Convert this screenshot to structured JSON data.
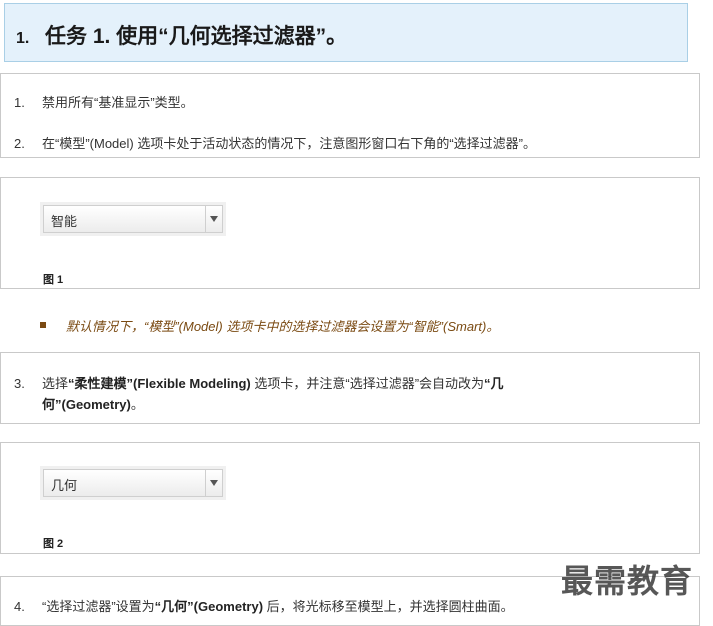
{
  "task": {
    "number": "1.",
    "title": "任务 1. 使用“几何选择过滤器”。"
  },
  "steps_a": [
    {
      "num": "1.",
      "text": "禁用所有“基准显示”类型。"
    },
    {
      "num": "2.",
      "text": "在“模型”(Model) 选项卡处于活动状态的情况下，注意图形窗口右下角的“选择过滤器”。"
    }
  ],
  "figure1": {
    "dropdown_value": "智能",
    "caption": "图 1"
  },
  "note": {
    "text": "默认情况下，“模型”(Model) 选项卡中的选择过滤器会设置为“智能”(Smart)。"
  },
  "step3": {
    "num": "3.",
    "part1": "选择",
    "bold1": "“柔性建模”(Flexible Modeling)",
    "part2": " 选项卡，并注意“选择过滤器”会自动改为",
    "bold2a": "“几",
    "bold2b": "何”(Geometry)",
    "part3": "。"
  },
  "figure2": {
    "dropdown_value": "几何",
    "caption": "图 2"
  },
  "step4": {
    "num": "4.",
    "part1": "“选择过滤器”设置为",
    "bold1": "“几何”(Geometry)",
    "part2": " 后，将光标移至模型上，并选择圆柱曲面。"
  },
  "watermark": "最需教育"
}
